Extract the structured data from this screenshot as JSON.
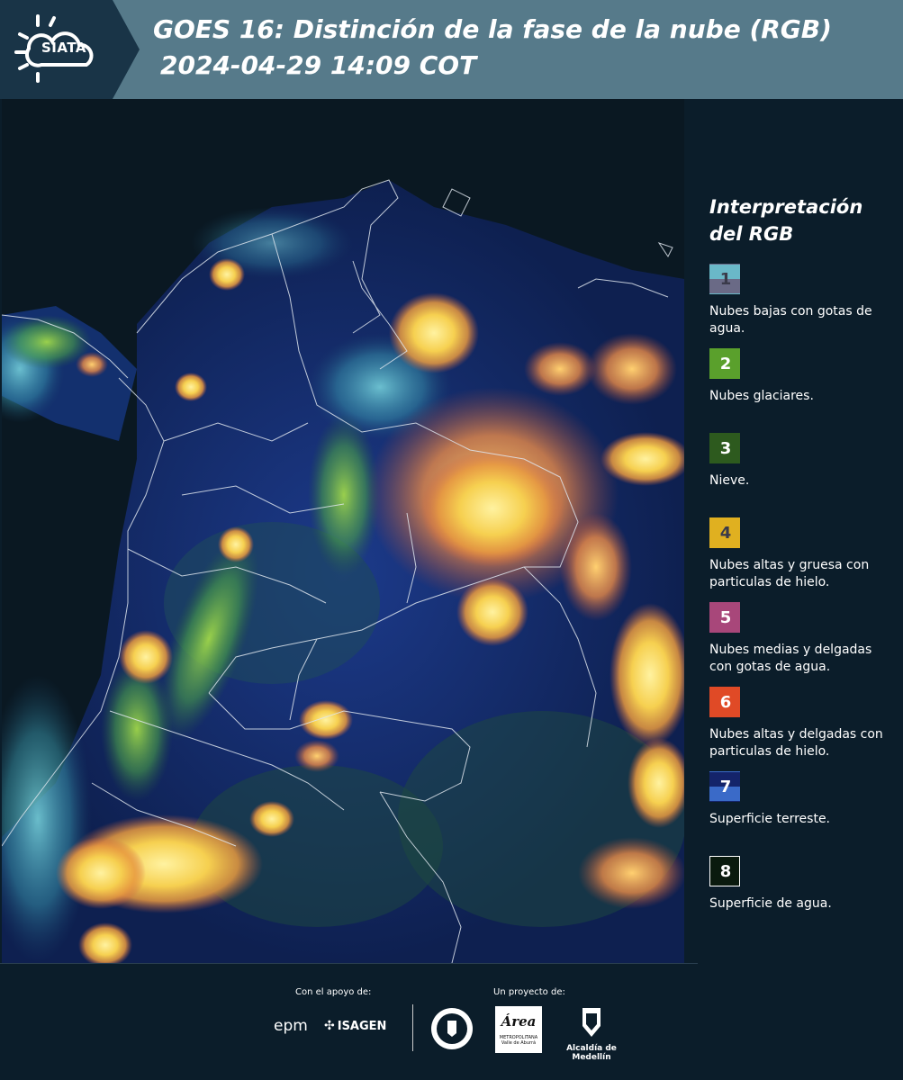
{
  "header": {
    "logo_text": "SIATA",
    "title": "GOES 16: Distinción de la fase de la nube (RGB)",
    "subtitle": "2024-04-29 14:09 COT"
  },
  "legend": {
    "title_line1": "Interpretación",
    "title_line2": "del RGB",
    "items": [
      {
        "num": "1",
        "label": "Nubes bajas con gotas de agua.",
        "color_top": "#6ab8c8",
        "color_bottom": "#6a6a86"
      },
      {
        "num": "2",
        "label": "Nubes glaciares.",
        "color_top": "#5aa02c",
        "color_bottom": "#5aa02c"
      },
      {
        "num": "3",
        "label": "Nieve.",
        "color_top": "#2d5a1e",
        "color_bottom": "#2d5a1e"
      },
      {
        "num": "4",
        "label": "Nubes altas y gruesa con particulas de hielo.",
        "color_top": "#e0b020",
        "color_bottom": "#e0b020"
      },
      {
        "num": "5",
        "label": "Nubes medias y delgadas con gotas de agua.",
        "color_top": "#a8477a",
        "color_bottom": "#a8477a"
      },
      {
        "num": "6",
        "label": "Nubes altas y delgadas con particulas de hielo.",
        "color_top": "#e04a26",
        "color_bottom": "#e04a26"
      },
      {
        "num": "7",
        "label": "Superficie terreste.",
        "color_top": "#14246a",
        "color_bottom": "#3a6ac8"
      },
      {
        "num": "8",
        "label": "Superficie de agua.",
        "color_top": "#0a1a0e",
        "color_bottom": "#0a1a0e"
      }
    ]
  },
  "footer": {
    "support_label": "Con el apoyo de:",
    "project_label": "Un proyecto de:",
    "partner_epm": "epm",
    "partner_isagen": "ISAGEN",
    "partner_area": "Área",
    "partner_area_sub1": "METROPOLITANA",
    "partner_area_sub2": "Valle de Aburrá",
    "partner_alcaldia": "Alcaldía de Medellín"
  }
}
